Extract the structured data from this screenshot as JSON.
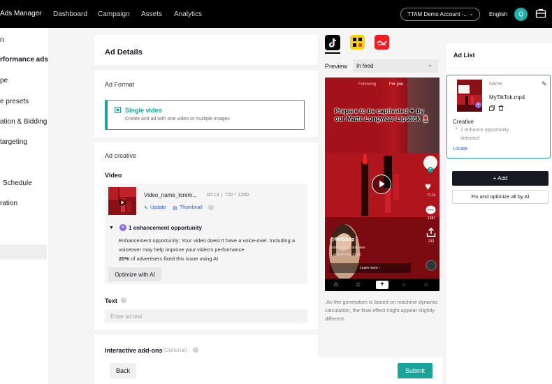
{
  "topbar": {
    "brand": "Ads Manager",
    "nav": [
      "Dashboard",
      "Campaign",
      "Assets",
      "Analytics"
    ],
    "account": "TTAM Demo Account -...",
    "language": "English",
    "avatar_initial": "Q"
  },
  "sidebar": {
    "items": [
      "n",
      "rformance ads",
      "pe",
      "e presets",
      "ation & Bidding",
      " targeting",
      "Schedule",
      "ration"
    ]
  },
  "ad_details": {
    "title": "Ad Details",
    "ad_format_label": "Ad Format",
    "format_card": {
      "title": "Single video",
      "desc": "Create and ad with one video or multiple images"
    },
    "creative_label": "Ad creative",
    "video_label": "Video",
    "video": {
      "name": "Video_name_lorem...",
      "duration": "00:13",
      "resolution": "720 * 1280",
      "update": "Update",
      "thumbnail": "Thumbnail"
    },
    "enhancement": {
      "title": "1 enhancement opportunity",
      "body": "Enhancement opportunity: Your video doesn't have a voice-over. Including a voiceover may help improve your video's performance",
      "stat_pct": "20%",
      "stat_rest": " of advertisers fixed this issue using AI",
      "button": "Optimize with AI"
    },
    "text_label": "Text",
    "text_placeholder": "Enter ad text",
    "addons_label": "Interactive add-ons",
    "addons_optional": "(Optional)"
  },
  "footer": {
    "back": "Back",
    "submit": "Submit"
  },
  "preview": {
    "label": "Preview",
    "placement": "In feed",
    "tabs": {
      "following": "Following",
      "for_you": "For you"
    },
    "caption": "Prepare to be captivated ✦ by our Matte Longwear Lipstick 💄",
    "handle": "@PetShop",
    "subtext": "Enter your ad text here",
    "music": "♫ promotional music",
    "cta": "Learn more",
    "likes": "71.1k",
    "comments": "1281",
    "shares": "232",
    "note": ".As the generation is based on machine dynamic calculation, the final effect might appear slightly different."
  },
  "ad_list": {
    "title": "Ad List",
    "name_label": "Name",
    "file": "MyTikTok.mp4",
    "creative": "Creative",
    "opportunity": "1 enhance opportunity detected",
    "locate": "Locate",
    "add": "+ Add",
    "fix_all": "Fix and optimize all by AI"
  },
  "colors": {
    "accent": "#1ba39b",
    "topbar": "#000000",
    "phone_bg": "#7a0d12"
  }
}
